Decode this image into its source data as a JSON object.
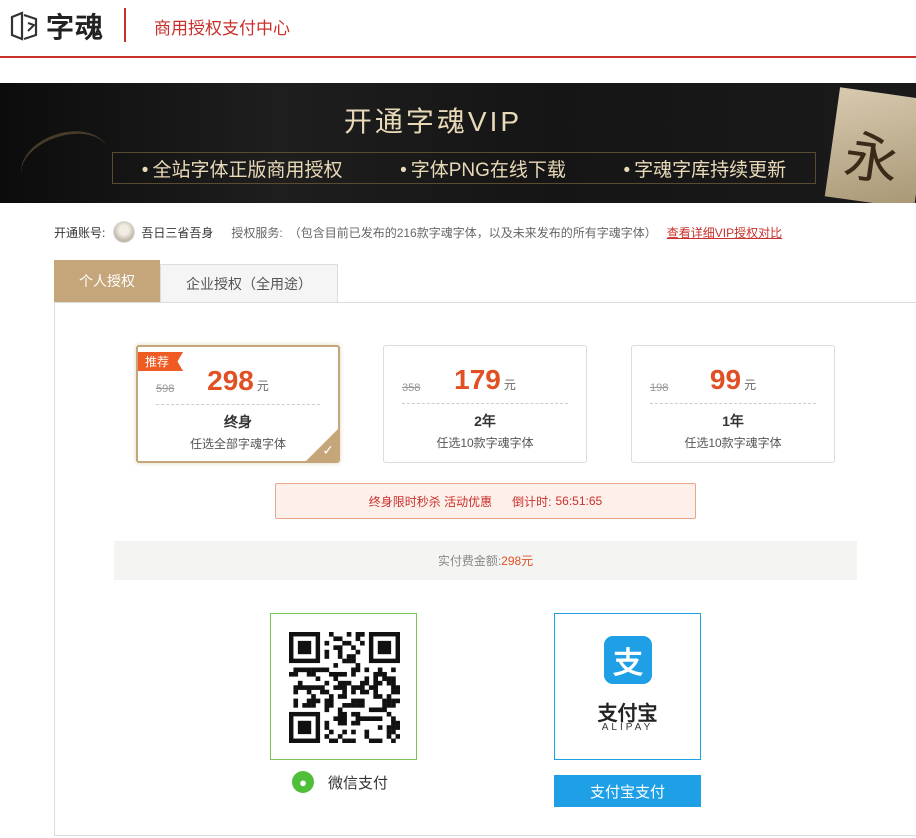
{
  "header": {
    "logo_text": "字魂",
    "title": "商用授权支付中心"
  },
  "banner": {
    "title": "开通字魂VIP",
    "features": [
      "全站字体正版商用授权",
      "字体PNG在线下载",
      "字魂字库持续更新"
    ],
    "deco_char": "永"
  },
  "account": {
    "label": "开通账号:",
    "username": "吾日三省吾身",
    "service_label": "授权服务:",
    "service_desc": "（包含目前已发布的216款字魂字体，以及未来发布的所有字魂字体）",
    "compare_link": "查看详细VIP授权对比"
  },
  "tabs": [
    {
      "label": "个人授权",
      "active": true
    },
    {
      "label": "企业授权（全用途）",
      "active": false
    }
  ],
  "plans": [
    {
      "badge": "推荐",
      "original": "598",
      "price": "298",
      "unit": "元",
      "term": "终身",
      "desc": "任选全部字魂字体",
      "selected": true
    },
    {
      "original": "358",
      "price": "179",
      "unit": "元",
      "term": "2年",
      "desc": "任选10款字魂字体",
      "selected": false
    },
    {
      "original": "198",
      "price": "99",
      "unit": "元",
      "term": "1年",
      "desc": "任选10款字魂字体",
      "selected": false
    }
  ],
  "promo": {
    "text": "终身限时秒杀 活动优惠",
    "countdown_label": "倒计时:",
    "countdown_value": "56:51:65"
  },
  "amount": {
    "label": "实付费金额:",
    "value": "298元"
  },
  "payment": {
    "wechat_label": "微信支付",
    "alipay_cn": "支付宝",
    "alipay_en": "ALIPAY",
    "alipay_icon_char": "支",
    "alipay_button": "支付宝支付"
  },
  "colors": {
    "brand_red": "#c9302c",
    "gold": "#c4a67a",
    "price_orange": "#e05023",
    "alipay_blue": "#1e9fe6",
    "wechat_green": "#4fbf3a"
  },
  "icons": {
    "logo": "zihun-logo-icon",
    "wechat": "wechat-icon",
    "alipay": "alipay-icon",
    "check": "checkmark-icon"
  }
}
